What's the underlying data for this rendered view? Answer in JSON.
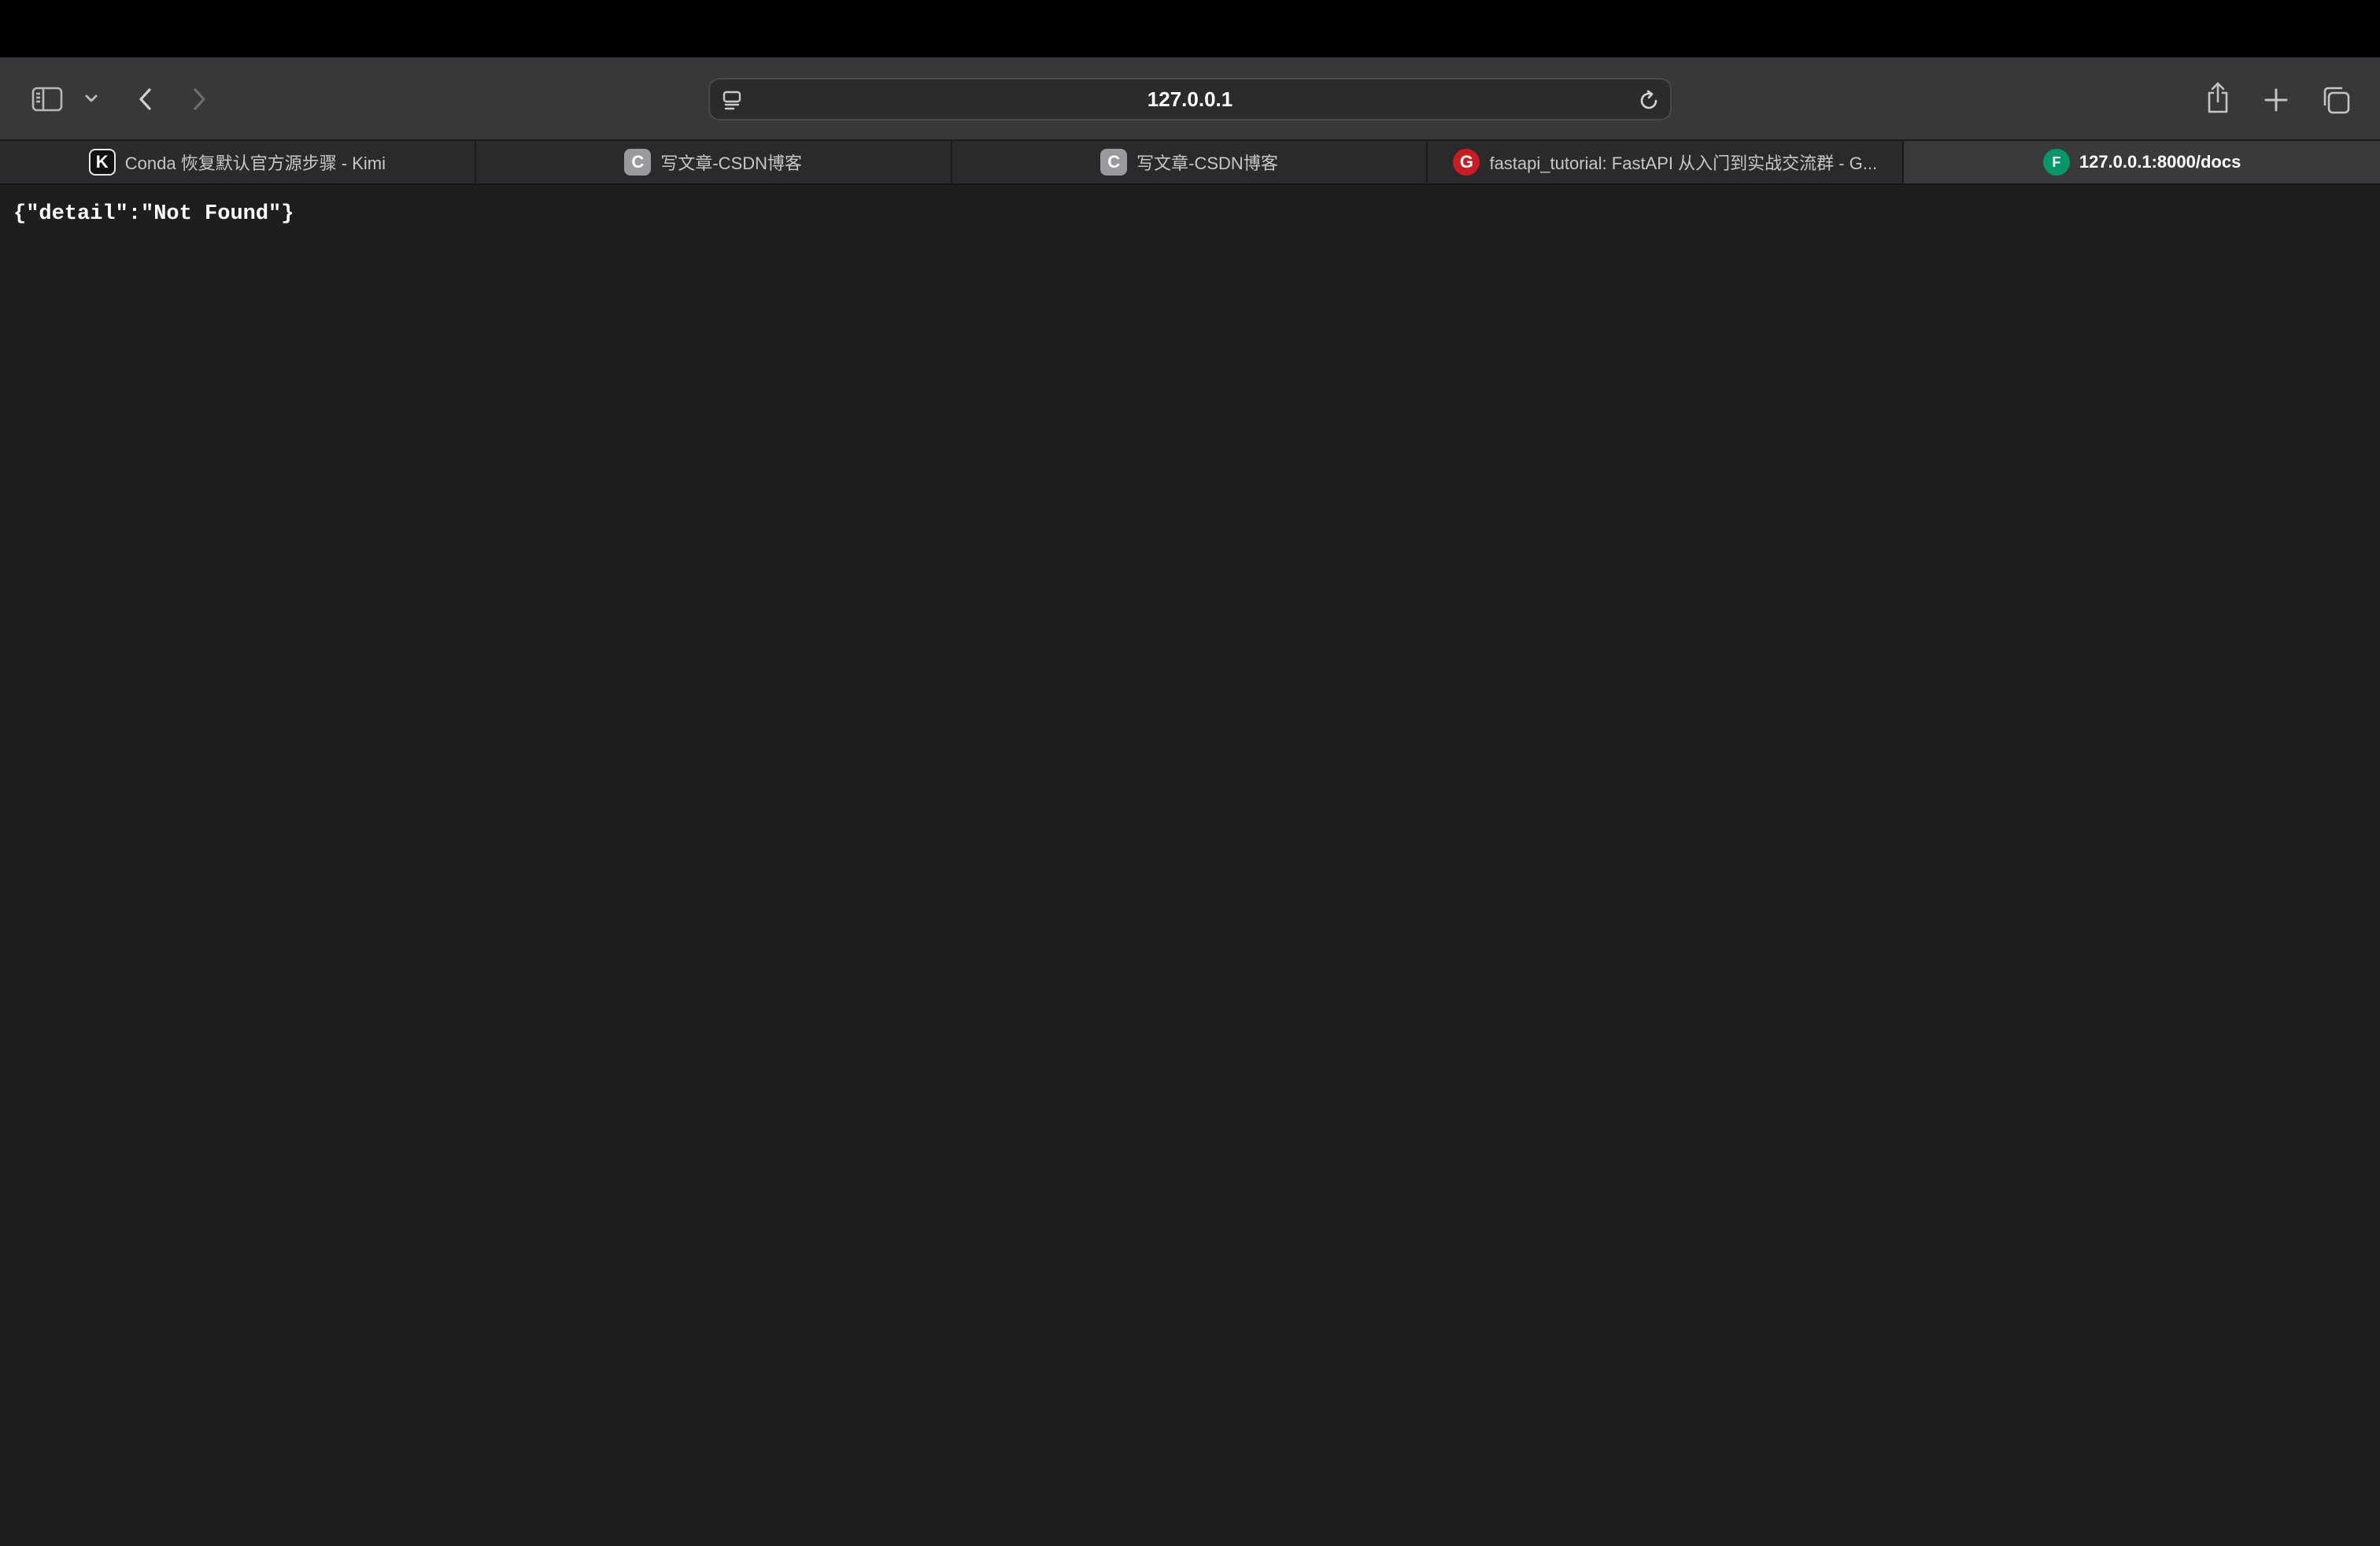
{
  "browser": {
    "address": "127.0.0.1",
    "toolbar_icons": {
      "sidebar": "sidebar-icon",
      "sidebar_menu": "chevron-down-icon",
      "back": "chevron-left-icon",
      "forward": "chevron-right-icon",
      "page_menu": "page-menu-icon",
      "reload": "reload-icon",
      "share": "share-icon",
      "new_tab": "plus-icon",
      "tab_overview": "tab-overview-icon"
    }
  },
  "tabs": [
    {
      "title": "Conda 恢复默认官方源步骤 - Kimi",
      "favicon": "K",
      "active": false
    },
    {
      "title": "写文章-CSDN博客",
      "favicon": "C",
      "active": false
    },
    {
      "title": "写文章-CSDN博客",
      "favicon": "C",
      "active": false
    },
    {
      "title": "fastapi_tutorial: FastAPI 从入门到实战交流群 - G...",
      "favicon": "G",
      "active": false
    },
    {
      "title": "127.0.0.1:8000/docs",
      "favicon": "F",
      "active": true
    }
  ],
  "page": {
    "body_text": "{\"detail\":\"Not Found\"}"
  },
  "colors": {
    "toolbar": "#38383a",
    "tabbar": "#2a2a2c",
    "active_tab": "#3a3a3c",
    "page_background": "#1e1e1e",
    "gitee_red": "#c71d23",
    "fastapi_green": "#059669"
  }
}
